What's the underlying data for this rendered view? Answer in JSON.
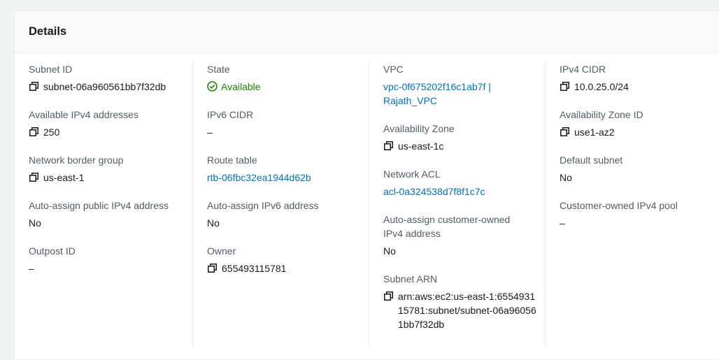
{
  "panel": {
    "title": "Details"
  },
  "columns": [
    [
      {
        "label": "Subnet ID",
        "value": "subnet-06a960561bb7f32db",
        "copy": true
      },
      {
        "label": "Available IPv4 addresses",
        "value": "250",
        "copy": true
      },
      {
        "label": "Network border group",
        "value": "us-east-1",
        "copy": true
      },
      {
        "label": "Auto-assign public IPv4 address",
        "value": "No"
      },
      {
        "label": "Outpost ID",
        "value": "–"
      }
    ],
    [
      {
        "label": "State",
        "value": "Available",
        "status": "success"
      },
      {
        "label": "IPv6 CIDR",
        "value": "–"
      },
      {
        "label": "Route table",
        "value": "rtb-06fbc32ea1944d62b",
        "link": true
      },
      {
        "label": "Auto-assign IPv6 address",
        "value": "No"
      },
      {
        "label": "Owner",
        "value": "655493115781",
        "copy": true
      }
    ],
    [
      {
        "label": "VPC",
        "value": "vpc-0f675202f16c1ab7f | Rajath_VPC",
        "link": true
      },
      {
        "label": "Availability Zone",
        "value": "us-east-1c",
        "copy": true
      },
      {
        "label": "Network ACL",
        "value": "acl-0a324538d7f8f1c7c",
        "link": true
      },
      {
        "label": "Auto-assign customer-owned IPv4 address",
        "value": "No"
      },
      {
        "label": "Subnet ARN",
        "value": "arn:aws:ec2:us-east-1:655493115781:subnet/subnet-06a960561bb7f32db",
        "copy": true
      }
    ],
    [
      {
        "label": "IPv4 CIDR",
        "value": "10.0.25.0/24",
        "copy": true
      },
      {
        "label": "Availability Zone ID",
        "value": "use1-az2",
        "copy": true
      },
      {
        "label": "Default subnet",
        "value": "No"
      },
      {
        "label": "Customer-owned IPv4 pool",
        "value": "–"
      }
    ]
  ],
  "colors": {
    "link": "#0073bb",
    "success": "#1d8102",
    "label": "#545b64"
  }
}
